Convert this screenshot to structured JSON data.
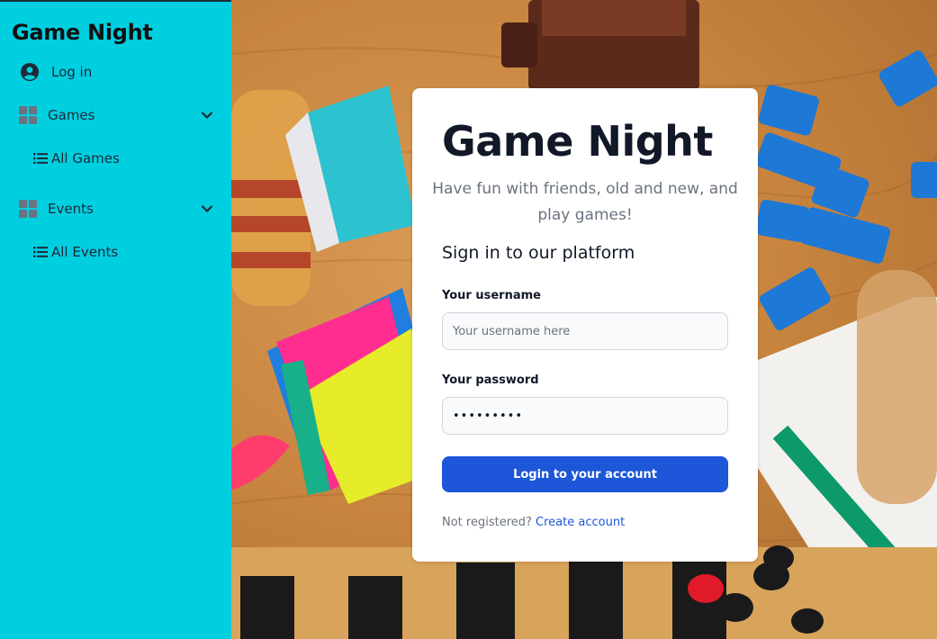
{
  "sidebar": {
    "brand": "Game Night",
    "items": [
      {
        "label": "Log in",
        "icon": "user-circle-icon"
      },
      {
        "label": "Games",
        "icon": "grid-icon",
        "expanded": true
      },
      {
        "label": "All Games",
        "icon": "list-icon"
      },
      {
        "label": "Events",
        "icon": "grid-icon",
        "expanded": true
      },
      {
        "label": "All Events",
        "icon": "list-icon"
      }
    ]
  },
  "login": {
    "title": "Game Night",
    "subtitle": "Have fun with friends, old and new, and play games!",
    "heading": "Sign in to our platform",
    "username_label": "Your username",
    "username_placeholder": "Your username here",
    "password_label": "Your password",
    "password_value": "•••••••••",
    "submit_label": "Login to your account",
    "register_prompt": "Not registered?",
    "register_link": "Create account"
  },
  "colors": {
    "sidebar_bg": "#00cfe0",
    "primary": "#1d56d8",
    "card_bg": "#ffffff"
  }
}
